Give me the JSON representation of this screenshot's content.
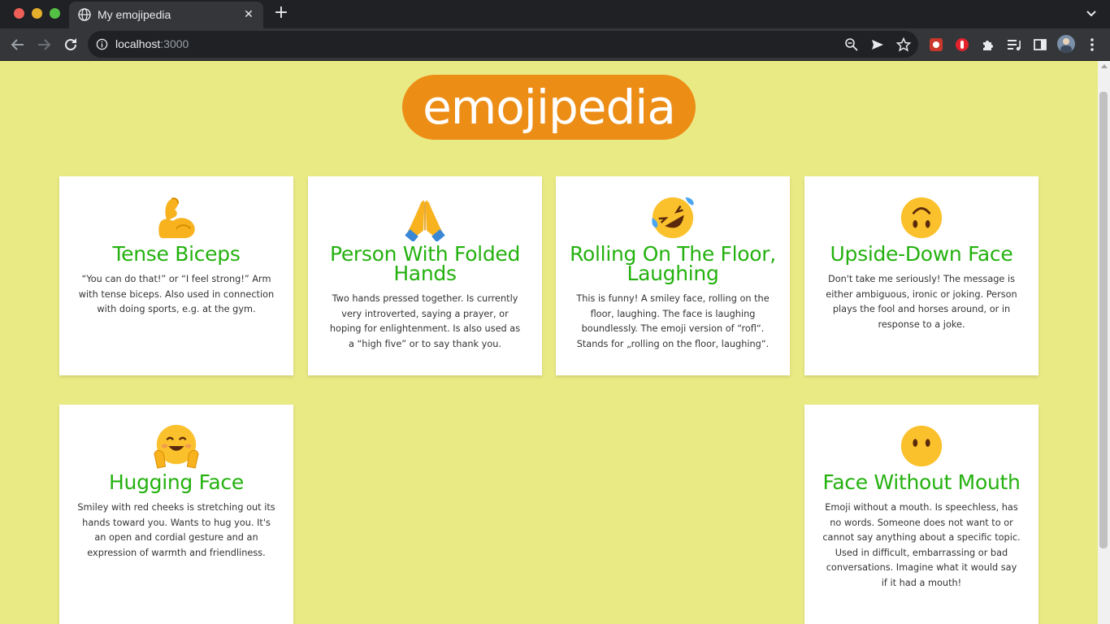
{
  "browser": {
    "tab_title": "My emojipedia",
    "new_tab": "+",
    "close_tab": "✕",
    "url_host": "localhost",
    "url_port": ":3000"
  },
  "page": {
    "brand": "emojipedia",
    "cards": [
      {
        "emoji": "flexed-biceps",
        "title": "Tense Biceps",
        "description": "“You can do that!” or “I feel strong!” Arm with tense biceps. Also used in connection with doing sports, e.g. at the gym."
      },
      {
        "emoji": "folded-hands",
        "title": "Person With Folded Hands",
        "description": "Two hands pressed together. Is currently very introverted, saying a prayer, or hoping for enlightenment. Is also used as a “high five” or to say thank you."
      },
      {
        "emoji": "rolling-on-floor-laughing",
        "title": "Rolling On The Floor, Laughing",
        "description": "This is funny! A smiley face, rolling on the floor, laughing. The face is laughing boundlessly. The emoji version of “rofl“. Stands for „rolling on the floor, laughing“."
      },
      {
        "emoji": "upside-down-face",
        "title": "Upside-Down Face",
        "description": "Don't take me seriously! The message is either ambiguous, ironic or joking. Person plays the fool and horses around, or in response to a joke."
      },
      {
        "emoji": "hugging-face",
        "title": "Hugging Face",
        "description": "Smiley with red cheeks is stretching out its hands toward you. Wants to hug you. It's an open and cordial gesture and an expression of warmth and friendliness."
      },
      {
        "emoji": "face-without-mouth",
        "title": "Face Without Mouth",
        "description": "Emoji without a mouth. Is speechless, has no words. Someone does not want to or cannot say anything about a specific topic. Used in difficult, embarrassing or bad conversations. Imagine what it would say if it had a mouth!"
      }
    ]
  },
  "colors": {
    "page_background": "#eaea85",
    "brand_background": "#ec8d16",
    "title_green": "#24b10f",
    "card_background": "#ffffff"
  }
}
